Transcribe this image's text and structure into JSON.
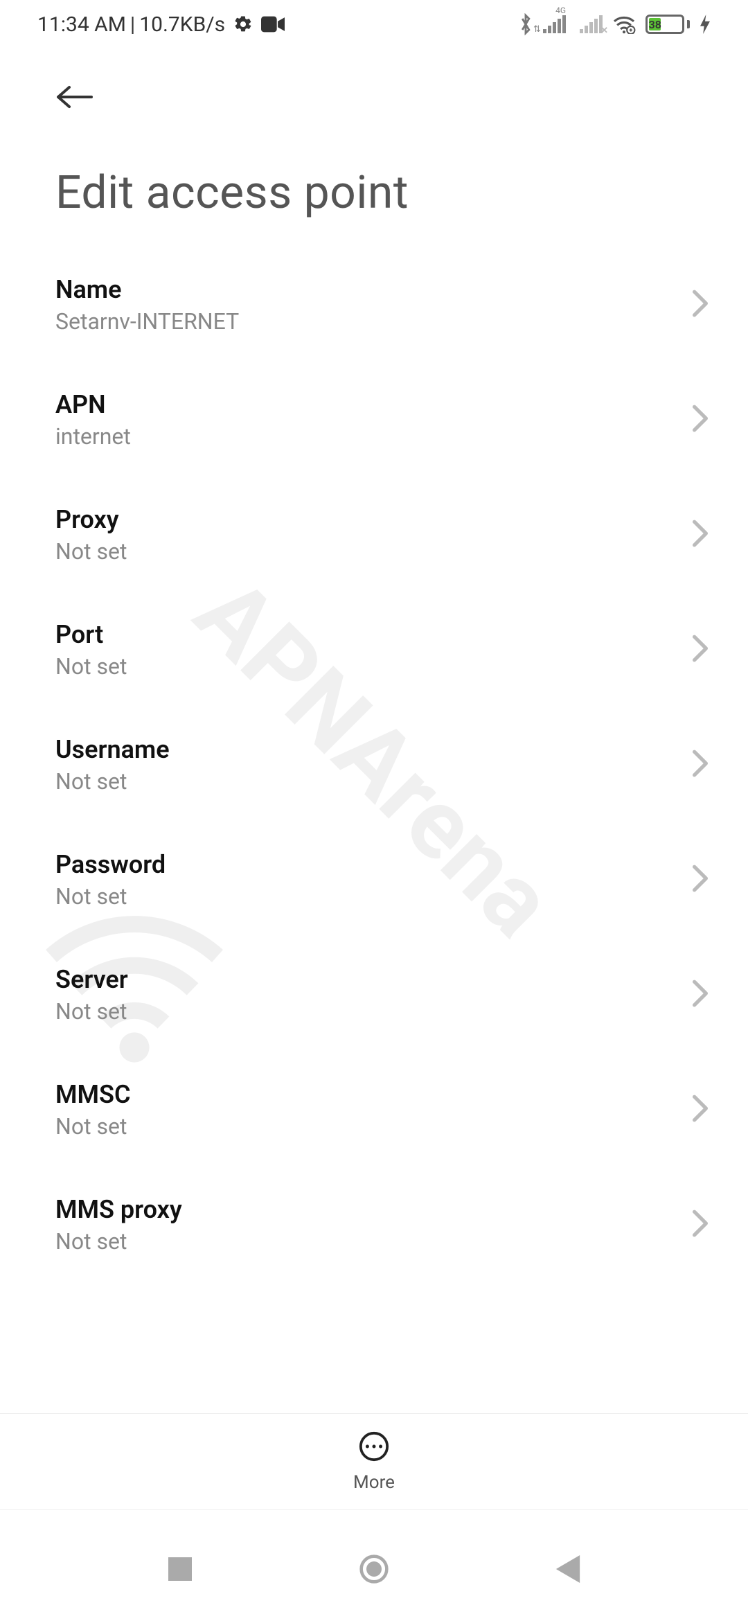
{
  "status": {
    "time": "11:34 AM",
    "data_rate": "10.7KB/s",
    "network_label": "4G",
    "battery_pct": "38"
  },
  "page": {
    "title": "Edit access point"
  },
  "fields": [
    {
      "label": "Name",
      "value": "Setarnv-INTERNET"
    },
    {
      "label": "APN",
      "value": "internet"
    },
    {
      "label": "Proxy",
      "value": "Not set"
    },
    {
      "label": "Port",
      "value": "Not set"
    },
    {
      "label": "Username",
      "value": "Not set"
    },
    {
      "label": "Password",
      "value": "Not set"
    },
    {
      "label": "Server",
      "value": "Not set"
    },
    {
      "label": "MMSC",
      "value": "Not set"
    },
    {
      "label": "MMS proxy",
      "value": "Not set"
    }
  ],
  "bottom": {
    "more": "More"
  },
  "watermark": "APNArena"
}
